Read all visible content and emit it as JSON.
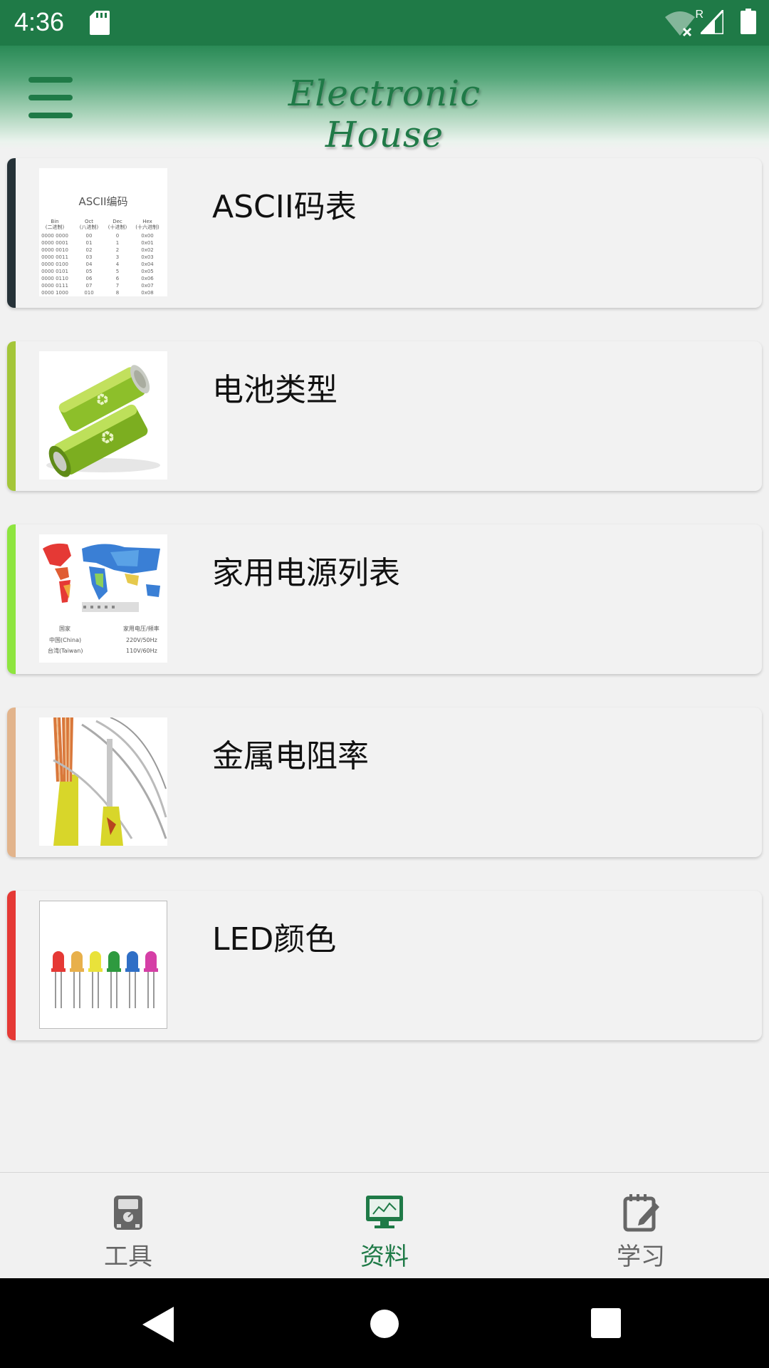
{
  "status_bar": {
    "time": "4:36",
    "icons": [
      "sd-card-icon",
      "wifi-off-icon",
      "signal-icon",
      "battery-icon"
    ],
    "roaming_label": "R"
  },
  "app_bar": {
    "title": "Electronic House",
    "menu_icon": "hamburger-menu-icon"
  },
  "list": {
    "items": [
      {
        "title": "ASCII码表",
        "stripe_color": "#263238",
        "thumb": "ascii-table-thumbnail",
        "thumb_text": {
          "heading": "ASCII编码",
          "cols": [
            "Bin",
            "Oct",
            "Dec",
            "Hex"
          ],
          "subcols": [
            "(二进制)",
            "(八进制)",
            "(十进制)",
            "(十六进制)"
          ],
          "rows": [
            [
              "0000 0000",
              "00",
              "0",
              "0x00"
            ],
            [
              "0000 0001",
              "01",
              "1",
              "0x01"
            ],
            [
              "0000 0010",
              "02",
              "2",
              "0x02"
            ],
            [
              "0000 0011",
              "03",
              "3",
              "0x03"
            ],
            [
              "0000 0100",
              "04",
              "4",
              "0x04"
            ],
            [
              "0000 0101",
              "05",
              "5",
              "0x05"
            ],
            [
              "0000 0110",
              "06",
              "6",
              "0x06"
            ],
            [
              "0000 0111",
              "07",
              "7",
              "0x07"
            ],
            [
              "0000 1000",
              "010",
              "8",
              "0x08"
            ]
          ]
        }
      },
      {
        "title": "电池类型",
        "stripe_color": "#a4c639",
        "thumb": "battery-thumbnail"
      },
      {
        "title": "家用电源列表",
        "stripe_color": "#8ee53f",
        "thumb": "world-map-thumbnail",
        "thumb_text": {
          "col1": "国家",
          "col2": "家用电压/频率",
          "r1c1": "中国(China)",
          "r1c2": "220V/50Hz",
          "r2c1": "台湾(Taiwan)",
          "r2c2": "110V/60Hz"
        }
      },
      {
        "title": "金属电阻率",
        "stripe_color": "#e2b48c",
        "thumb": "metal-wire-thumbnail"
      },
      {
        "title": "LED颜色",
        "stripe_color": "#e53935",
        "thumb": "led-thumbnail"
      }
    ]
  },
  "bottom_nav": {
    "items": [
      {
        "label": "工具",
        "icon": "multimeter-icon",
        "active": false
      },
      {
        "label": "资料",
        "icon": "monitor-icon",
        "active": true
      },
      {
        "label": "学习",
        "icon": "notepad-edit-icon",
        "active": false
      }
    ],
    "active_color": "#1f7a47",
    "inactive_color": "#666666"
  },
  "system_nav": {
    "icons": [
      "back-icon",
      "home-icon",
      "recents-icon"
    ]
  }
}
